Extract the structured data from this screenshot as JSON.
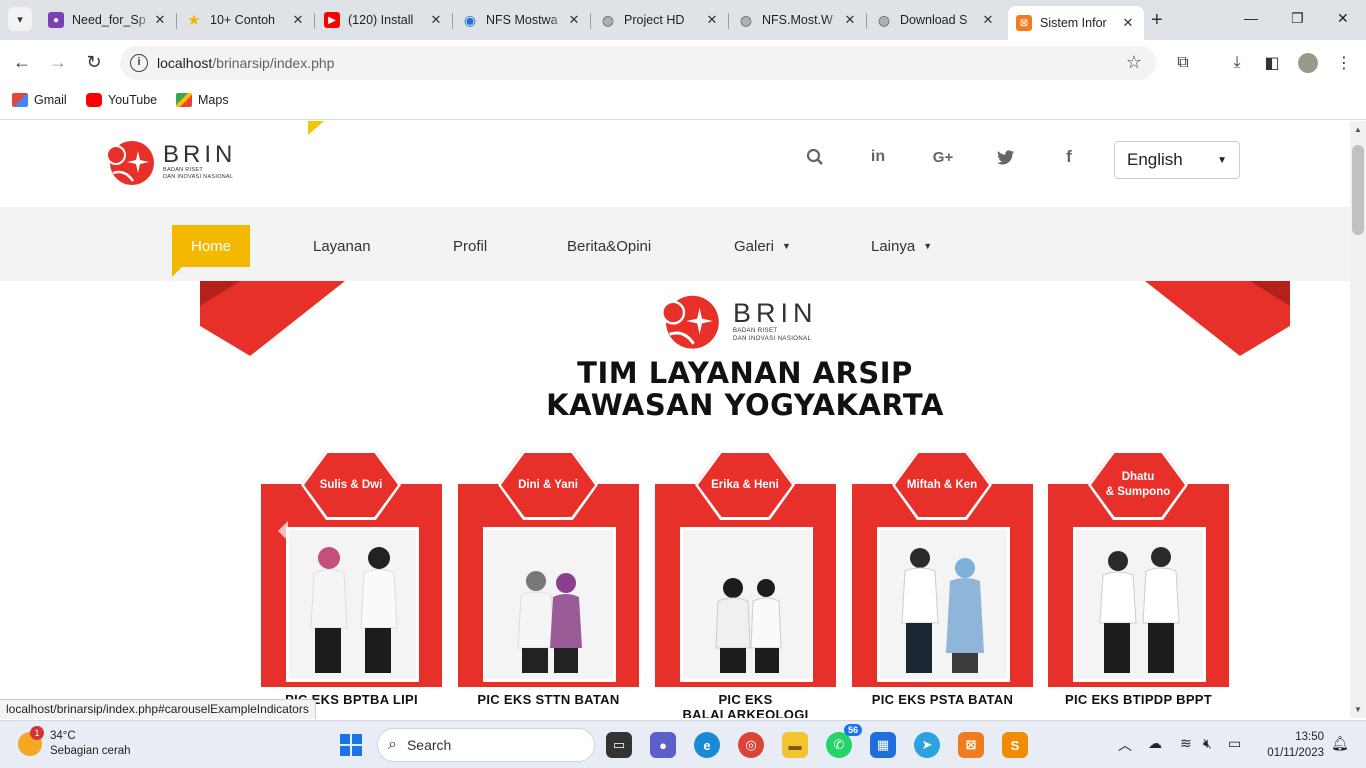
{
  "browser": {
    "tabs": [
      {
        "label": "Need_for_Sp",
        "icon": "purple-app-icon",
        "color": "#7b3fb1"
      },
      {
        "label": "10+ Contoh",
        "icon": "star-icon",
        "color": "#f2b600"
      },
      {
        "label": "(120) Install",
        "icon": "youtube-icon",
        "color": "#ff0000"
      },
      {
        "label": "NFS Mostwa",
        "icon": "blue-wave-icon",
        "color": "#1e6fd9"
      },
      {
        "label": "Project HD",
        "icon": "globe-icon",
        "color": "#5f6368"
      },
      {
        "label": "NFS.Most.W",
        "icon": "globe-icon",
        "color": "#5f6368"
      },
      {
        "label": "Download S",
        "icon": "globe-icon",
        "color": "#5f6368"
      },
      {
        "label": "Sistem Infor",
        "icon": "xampp-icon",
        "color": "#f07c1f"
      }
    ],
    "url_host": "localhost",
    "url_path": "/brinarsip/index.php",
    "bookmarks": [
      {
        "label": "Gmail",
        "icon": "gmail-icon"
      },
      {
        "label": "YouTube",
        "icon": "youtube-icon"
      },
      {
        "label": "Maps",
        "icon": "maps-icon"
      }
    ],
    "status_url": "localhost/brinarsip/index.php#carouselExampleIndicators"
  },
  "site": {
    "logo_big": "BRIN",
    "logo_small_1": "BADAN RISET",
    "logo_small_2": "DAN INOVASI NASIONAL",
    "language": "English",
    "nav": [
      {
        "label": "Home",
        "active": true,
        "dropdown": false
      },
      {
        "label": "Layanan",
        "active": false,
        "dropdown": false
      },
      {
        "label": "Profil",
        "active": false,
        "dropdown": false
      },
      {
        "label": "Berita&Opini",
        "active": false,
        "dropdown": false
      },
      {
        "label": "Galeri",
        "active": false,
        "dropdown": true
      },
      {
        "label": "Lainya",
        "active": false,
        "dropdown": true
      }
    ],
    "banner": {
      "logo_big": "BRIN",
      "logo_small_1": "BADAN RISET",
      "logo_small_2": "DAN INOVASI NASIONAL",
      "title_line1": "TIM LAYANAN ARSIP",
      "title_line2": "KAWASAN YOGYAKARTA",
      "cards": [
        {
          "names": "Sulis & Dwi",
          "names2": "",
          "caption": "PIC EKS BPTBA LIPI",
          "caption2": ""
        },
        {
          "names": "Dini & Yani",
          "names2": "",
          "caption": "PIC EKS STTN BATAN",
          "caption2": ""
        },
        {
          "names": "Erika & Heni",
          "names2": "",
          "caption": "PIC EKS",
          "caption2": "BALAI ARKEOLOGI"
        },
        {
          "names": "Miftah & Ken",
          "names2": "",
          "caption": "PIC EKS PSTA BATAN",
          "caption2": ""
        },
        {
          "names": "Dhatu",
          "names2": "& Sumpono",
          "caption": "PIC EKS BTIPDP BPPT",
          "caption2": ""
        }
      ]
    }
  },
  "taskbar": {
    "weather_temp": "34°C",
    "weather_desc": "Sebagian cerah",
    "weather_badge": "1",
    "search_placeholder": "Search",
    "whatsapp_count": "56",
    "time": "13:50",
    "date": "01/11/2023"
  },
  "colors": {
    "brand_red": "#e8302a",
    "nav_active": "#f5b800"
  }
}
